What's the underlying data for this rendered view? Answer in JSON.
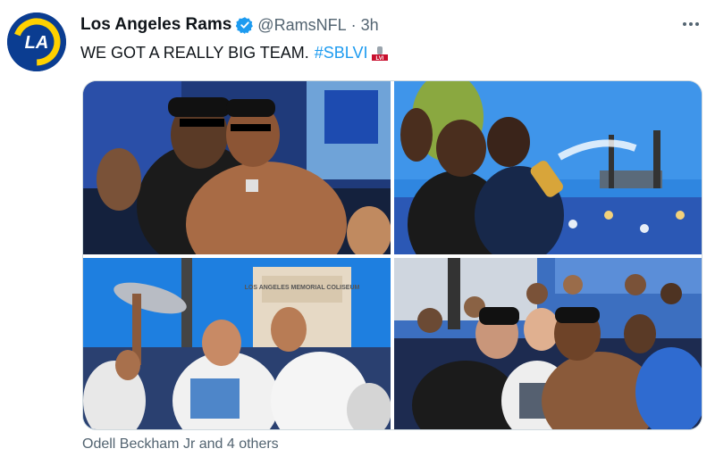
{
  "tweet": {
    "display_name": "Los Angeles Rams",
    "handle": "@RamsNFL",
    "separator": "·",
    "time": "3h",
    "text": "WE GOT A REALLY BIG TEAM.",
    "hashtag": "#SBLVI",
    "avatar_logo_text": "LA",
    "icons": {
      "verified": "verified-badge-icon",
      "more": "more-options-icon",
      "superbowl": "super-bowl-logo-icon"
    },
    "colors": {
      "avatar_bg": "#0b3d91",
      "avatar_logo": "#ffd100",
      "hashtag": "#1d9bf0",
      "verified": "#1d9bf0",
      "secondary_text": "#536471"
    }
  },
  "media": {
    "photos": [
      {
        "alt": "two players posing with peace sign at parade"
      },
      {
        "alt": "players spraying champagne in front of crowd"
      },
      {
        "alt": "player lifting trophy near coliseum"
      },
      {
        "alt": "group of players and fans with shirts"
      }
    ],
    "signage": "LOS ANGELES MEMORIAL COLISEUM"
  },
  "tagged_people": "Odell Beckham Jr and 4 others"
}
